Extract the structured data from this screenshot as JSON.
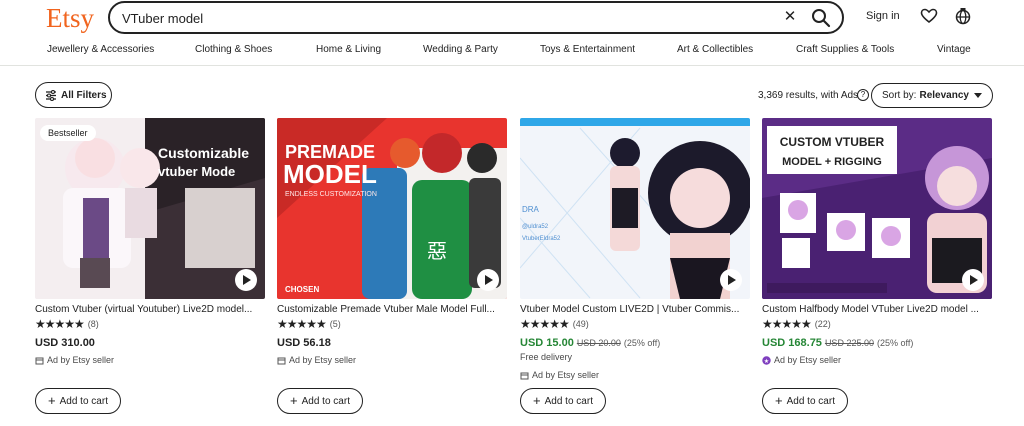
{
  "header": {
    "logo": "Etsy",
    "search_value": "VTuber model",
    "sign_in": "Sign in"
  },
  "categories": [
    "Jewellery & Accessories",
    "Clothing & Shoes",
    "Home & Living",
    "Wedding & Party",
    "Toys & Entertainment",
    "Art & Collectibles",
    "Craft Supplies & Tools",
    "Vintage"
  ],
  "toolbar": {
    "filters_label": "All Filters",
    "results_text": "3,369 results, with Ads",
    "sort_prefix": "Sort by:",
    "sort_value": "Relevancy"
  },
  "listings": [
    {
      "badge": "Bestseller",
      "title": "Custom Vtuber (virtual Youtuber) Live2D model...",
      "stars": "★★★★★",
      "reviews": "(8)",
      "price": "USD 310.00",
      "ad_label": "Ad by Etsy seller",
      "cart_label": "Add to cart",
      "thumb_text": [
        "Customizable",
        "vtuber Mode"
      ]
    },
    {
      "title": "Customizable Premade Vtuber Male Model Full...",
      "stars": "★★★★★",
      "reviews": "(5)",
      "price": "USD 56.18",
      "ad_label": "Ad by Etsy seller",
      "cart_label": "Add to cart",
      "thumb_text": [
        "PREMADE",
        "MODEL",
        "ENDLESS CUSTOMIZATION",
        "CHOSEN"
      ]
    },
    {
      "title": "Vtuber Model Custom LIVE2D | Vtuber Commis...",
      "stars": "★★★★★",
      "reviews": "(49)",
      "price": "USD 15.00",
      "original_price": "USD 20.00",
      "discount": "(25% off)",
      "delivery": "Free delivery",
      "ad_label": "Ad by Etsy seller",
      "cart_label": "Add to cart",
      "thumb_text": [
        "DRA",
        "@uldra52",
        "VtuberEldra52"
      ]
    },
    {
      "title": "Custom Halfbody Model VTuber Live2D model ...",
      "stars": "★★★★★",
      "reviews": "(22)",
      "price": "USD 168.75",
      "original_price": "USD 225.00",
      "discount": "(25% off)",
      "ad_label": "Ad by Etsy seller",
      "cart_label": "Add to cart",
      "thumb_text": [
        "CUSTOM VTUBER",
        "MODEL + RIGGING"
      ]
    }
  ],
  "colors": {
    "brand": "#f1641e",
    "sale_price": "#258635",
    "text": "#222222",
    "border": "#222222"
  }
}
